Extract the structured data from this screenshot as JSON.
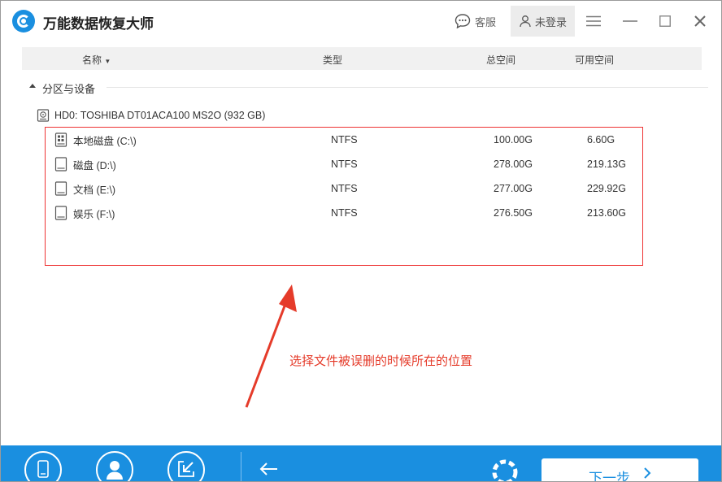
{
  "app": {
    "title": "万能数据恢复大师"
  },
  "toolbar": {
    "service_label": "客服",
    "login_label": "未登录"
  },
  "columns": {
    "name": "名称",
    "type": "类型",
    "total": "总空间",
    "free": "可用空间"
  },
  "section": {
    "label": "分区与设备"
  },
  "disk": {
    "label": "HD0: TOSHIBA DT01ACA100 MS2O (932 GB)"
  },
  "partitions": [
    {
      "name": "本地磁盘 (C:\\)",
      "type": "NTFS",
      "total": "100.00G",
      "free": "6.60G",
      "icon": "system-drive-icon"
    },
    {
      "name": "磁盘 (D:\\)",
      "type": "NTFS",
      "total": "278.00G",
      "free": "219.13G",
      "icon": "drive-icon"
    },
    {
      "name": "文档 (E:\\)",
      "type": "NTFS",
      "total": "277.00G",
      "free": "229.92G",
      "icon": "drive-icon"
    },
    {
      "name": "娱乐 (F:\\)",
      "type": "NTFS",
      "total": "276.50G",
      "free": "213.60G",
      "icon": "drive-icon"
    }
  ],
  "annotation": {
    "text": "选择文件被误删的时候所在的位置"
  },
  "footer": {
    "next_label": "下一步"
  },
  "colors": {
    "accent": "#1a8fe0",
    "annotation": "#e53b2a"
  }
}
